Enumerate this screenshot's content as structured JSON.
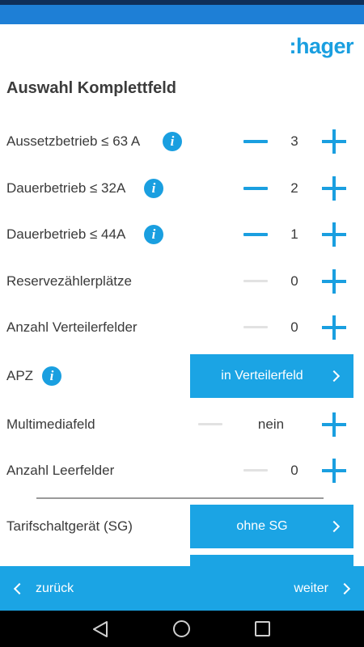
{
  "brand": {
    "logo_text": ":hager",
    "accent_color": "#1a9fe0"
  },
  "page": {
    "title": "Auswahl Komplettfeld"
  },
  "rows": [
    {
      "label": "Aussetzbetrieb ≤ 63 A",
      "value": "3",
      "info_icon": "info-icon",
      "minus_enabled": true
    },
    {
      "label": "Dauerbetrieb ≤ 32A",
      "value": "2",
      "info_icon": "info-icon",
      "minus_enabled": true
    },
    {
      "label": "Dauerbetrieb ≤ 44A",
      "value": "1",
      "info_icon": "info-icon",
      "minus_enabled": true
    },
    {
      "label": "Reservezählerplätze",
      "value": "0",
      "minus_enabled": false
    },
    {
      "label": "Anzahl Verteilerfelder",
      "value": "0",
      "minus_enabled": false
    },
    {
      "label": "APZ",
      "info_icon": "info-icon",
      "select_value": "in Verteilerfeld"
    },
    {
      "label": "Multimediafeld",
      "value": "nein",
      "minus_enabled": false
    },
    {
      "label": "Anzahl Leerfelder",
      "value": "0",
      "minus_enabled": false
    },
    {
      "label": "Tarifschaltgerät (SG)",
      "select_value": "ohne SG"
    }
  ],
  "icons": {
    "info": "i"
  },
  "footer": {
    "back_label": "zurück",
    "next_label": "weiter"
  }
}
